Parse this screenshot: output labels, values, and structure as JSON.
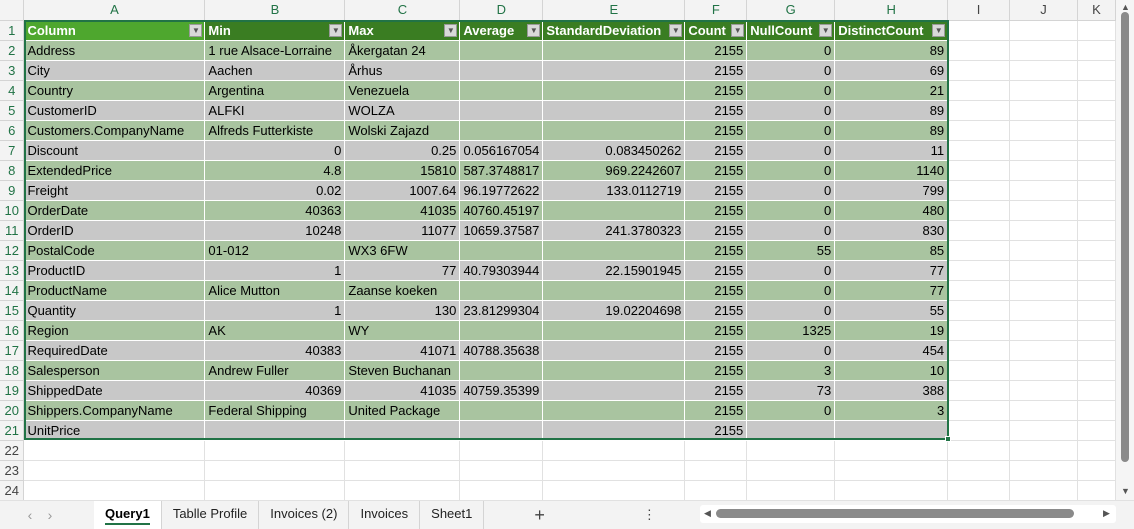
{
  "columns": [
    "A",
    "B",
    "C",
    "D",
    "E",
    "F",
    "G",
    "H",
    "I",
    "J",
    "K"
  ],
  "headers": [
    "Column",
    "Min",
    "Max",
    "Average",
    "StandardDeviation",
    "Count",
    "NullCount",
    "DistinctCount"
  ],
  "rows": [
    [
      "Address",
      "1 rue Alsace-Lorraine",
      "Åkergatan 24",
      "",
      "",
      "2155",
      "0",
      "89"
    ],
    [
      "City",
      "Aachen",
      "Århus",
      "",
      "",
      "2155",
      "0",
      "69"
    ],
    [
      "Country",
      "Argentina",
      "Venezuela",
      "",
      "",
      "2155",
      "0",
      "21"
    ],
    [
      "CustomerID",
      "ALFKI",
      "WOLZA",
      "",
      "",
      "2155",
      "0",
      "89"
    ],
    [
      "Customers.CompanyName",
      "Alfreds Futterkiste",
      "Wolski  Zajazd",
      "",
      "",
      "2155",
      "0",
      "89"
    ],
    [
      "Discount",
      "0",
      "0.25",
      "0.056167054",
      "0.083450262",
      "2155",
      "0",
      "11"
    ],
    [
      "ExtendedPrice",
      "4.8",
      "15810",
      "587.3748817",
      "969.2242607",
      "2155",
      "0",
      "1140"
    ],
    [
      "Freight",
      "0.02",
      "1007.64",
      "96.19772622",
      "133.0112719",
      "2155",
      "0",
      "799"
    ],
    [
      "OrderDate",
      "40363",
      "41035",
      "40760.45197",
      "",
      "2155",
      "0",
      "480"
    ],
    [
      "OrderID",
      "10248",
      "11077",
      "10659.37587",
      "241.3780323",
      "2155",
      "0",
      "830"
    ],
    [
      "PostalCode",
      "01-012",
      "WX3 6FW",
      "",
      "",
      "2155",
      "55",
      "85"
    ],
    [
      "ProductID",
      "1",
      "77",
      "40.79303944",
      "22.15901945",
      "2155",
      "0",
      "77"
    ],
    [
      "ProductName",
      "Alice Mutton",
      "Zaanse koeken",
      "",
      "",
      "2155",
      "0",
      "77"
    ],
    [
      "Quantity",
      "1",
      "130",
      "23.81299304",
      "19.02204698",
      "2155",
      "0",
      "55"
    ],
    [
      "Region",
      "AK",
      "WY",
      "",
      "",
      "2155",
      "1325",
      "19"
    ],
    [
      "RequiredDate",
      "40383",
      "41071",
      "40788.35638",
      "",
      "2155",
      "0",
      "454"
    ],
    [
      "Salesperson",
      "Andrew Fuller",
      "Steven Buchanan",
      "",
      "",
      "2155",
      "3",
      "10"
    ],
    [
      "ShippedDate",
      "40369",
      "41035",
      "40759.35399",
      "",
      "2155",
      "73",
      "388"
    ],
    [
      "Shippers.CompanyName",
      "Federal Shipping",
      "United Package",
      "",
      "",
      "2155",
      "0",
      "3"
    ],
    [
      "UnitPrice",
      "",
      "",
      "",
      "",
      "2155",
      "",
      ""
    ]
  ],
  "row_count": 24,
  "sheet_tabs": [
    "Query1",
    "Tablle Profile",
    "Invoices (2)",
    "Invoices",
    "Sheet1"
  ],
  "active_tab": "Query1",
  "add_sheet": "+",
  "more": "⋮"
}
